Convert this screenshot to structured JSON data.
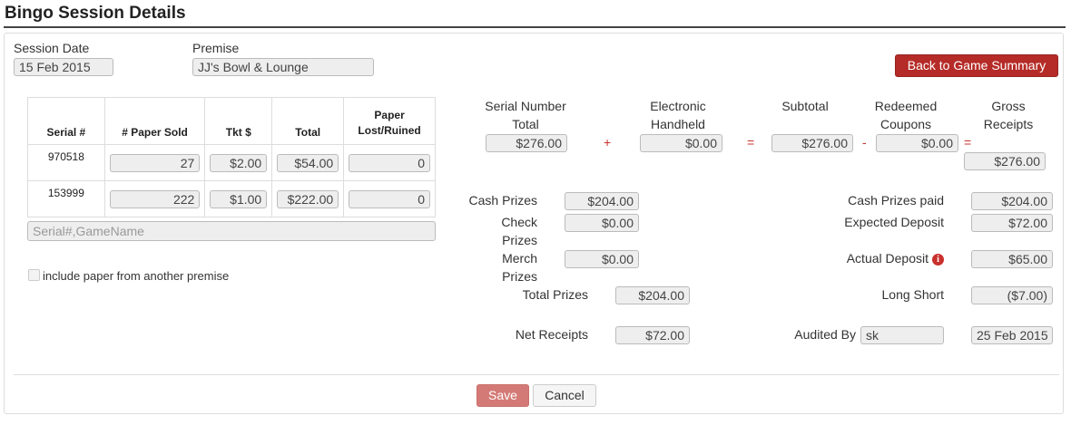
{
  "page": {
    "title": "Bingo Session Details"
  },
  "header": {
    "session_date_label": "Session Date",
    "session_date_value": "15 Feb 2015",
    "premise_label": "Premise",
    "premise_value": "JJ's Bowl & Lounge",
    "back_button": "Back to Game Summary"
  },
  "table": {
    "headers": [
      "Serial #",
      "# Paper Sold",
      "Tkt $",
      "Total",
      "Paper Lost/Ruined"
    ],
    "rows": [
      {
        "serial": "970518",
        "paper_sold": "27",
        "tkt": "$2.00",
        "total": "$54.00",
        "lost": "0"
      },
      {
        "serial": "153999",
        "paper_sold": "222",
        "tkt": "$1.00",
        "total": "$222.00",
        "lost": "0"
      }
    ]
  },
  "serial_search": {
    "placeholder": "Serial#,GameName"
  },
  "include_paper_label": "include paper from another premise",
  "summary": {
    "serial_total_label": "Serial Number Total",
    "serial_total": "$276.00",
    "plus": "+",
    "electronic_label": "Electronic Handheld",
    "electronic": "$0.00",
    "equals1": "=",
    "subtotal_label": "Subtotal",
    "subtotal": "$276.00",
    "minus": "-",
    "redeemed_label": "Redeemed Coupons",
    "redeemed": "$0.00",
    "equals2": "=",
    "gross_label": "Gross Receipts",
    "gross": "$276.00"
  },
  "prizes": {
    "cash_label": "Cash Prizes",
    "cash": "$204.00",
    "check_label": "Check Prizes",
    "check": "$0.00",
    "merch_label": "Merch Prizes",
    "merch": "$0.00",
    "total_label": "Total Prizes",
    "total": "$204.00",
    "net_label": "Net Receipts",
    "net": "$72.00"
  },
  "deposit": {
    "cash_paid_label": "Cash Prizes paid",
    "cash_paid": "$204.00",
    "expected_label": "Expected Deposit",
    "expected": "$72.00",
    "actual_label": "Actual Deposit",
    "actual": "$65.00",
    "long_short_label": "Long Short",
    "long_short": "($7.00)",
    "audited_label": "Audited By",
    "audited_by": "sk",
    "audited_date": "25 Feb 2015"
  },
  "footer": {
    "save": "Save",
    "cancel": "Cancel"
  },
  "colors": {
    "accent": "#b52b27",
    "operator": "#c9302c",
    "save_disabled": "#d47a76"
  },
  "icons": {
    "info": "info-circle-icon",
    "checkbox": "checkbox-icon"
  }
}
